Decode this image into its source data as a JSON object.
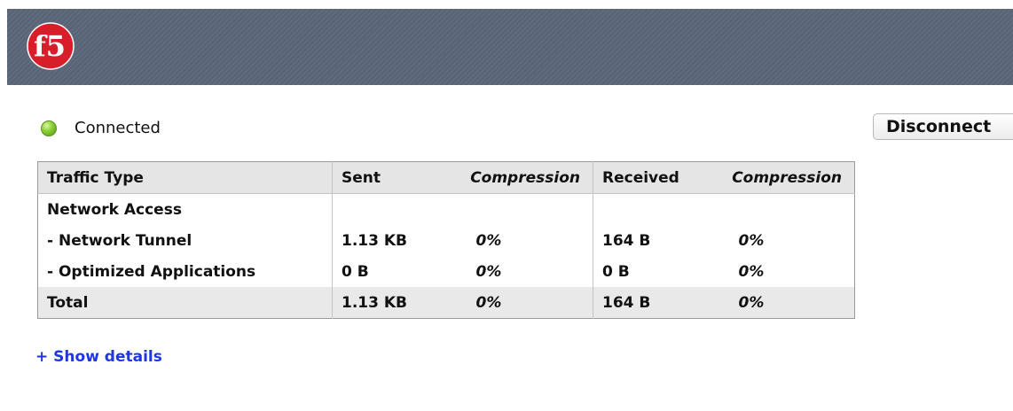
{
  "header": {
    "logo_text": "f5",
    "brand_color": "#d91e2b",
    "background_color": "#596577"
  },
  "status": {
    "text": "Connected",
    "indicator_color": "#7bc22c"
  },
  "actions": {
    "disconnect_label": "Disconnect"
  },
  "table": {
    "headers": {
      "traffic_type": "Traffic Type",
      "sent": "Sent",
      "sent_compression": "Compression",
      "received": "Received",
      "received_compression": "Compression"
    },
    "rows": [
      {
        "type": "Network Access",
        "sent": "",
        "sent_compression": "",
        "received": "",
        "received_compression": ""
      },
      {
        "type": "- Network Tunnel",
        "sent": "1.13 KB",
        "sent_compression": "0%",
        "received": "164 B",
        "received_compression": "0%"
      },
      {
        "type": "- Optimized Applications",
        "sent": "0 B",
        "sent_compression": "0%",
        "received": "0 B",
        "received_compression": "0%"
      }
    ],
    "total": {
      "type": "Total",
      "sent": "1.13 KB",
      "sent_compression": "0%",
      "received": "164 B",
      "received_compression": "0%"
    }
  },
  "links": {
    "show_details": "+ Show details"
  }
}
